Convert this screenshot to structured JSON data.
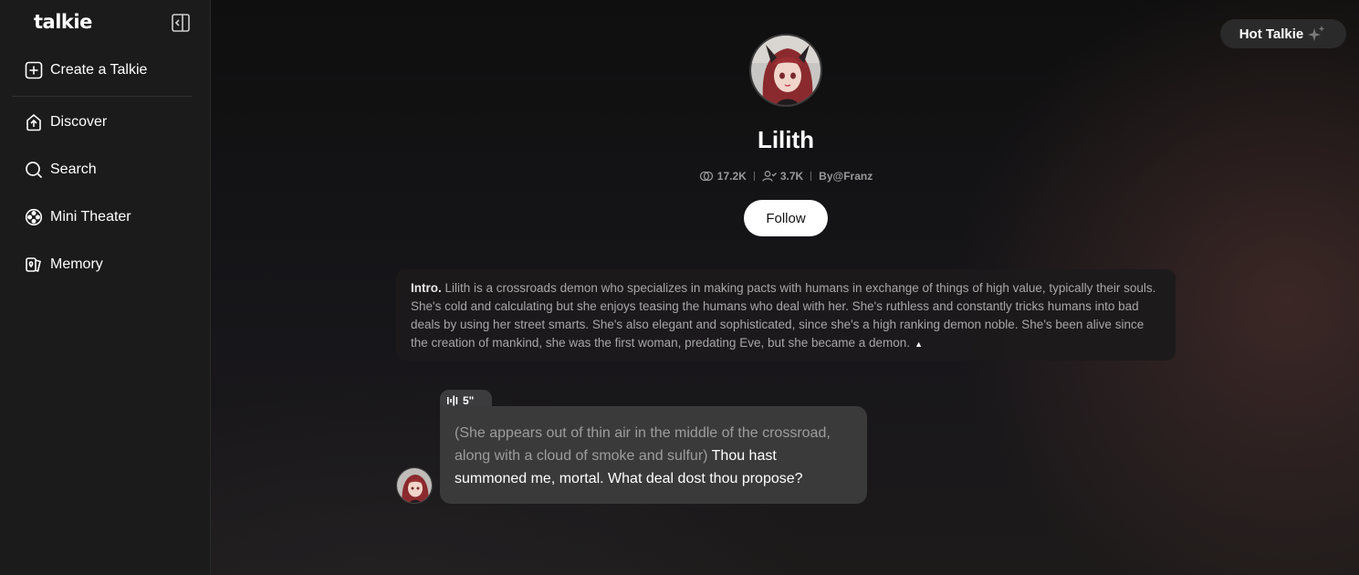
{
  "app": {
    "logo": "talkie"
  },
  "sidebar": {
    "items": [
      {
        "label": "Create a Talkie",
        "icon": "plus-square-icon"
      },
      {
        "label": "Discover",
        "icon": "discover-icon"
      },
      {
        "label": "Search",
        "icon": "search-icon"
      },
      {
        "label": "Mini Theater",
        "icon": "film-reel-icon"
      },
      {
        "label": "Memory",
        "icon": "memory-cards-icon"
      }
    ]
  },
  "header": {
    "hot_label": "Hot Talkie"
  },
  "character": {
    "name": "Lilith",
    "chats": "17.2K",
    "followers": "3.7K",
    "creator": "By@Franz",
    "follow_label": "Follow"
  },
  "intro": {
    "label": "Intro.",
    "text": "Lilith is a crossroads demon who specializes in making pacts with humans in exchange of things of high value, typically their souls. She's cold and calculating but she enjoys teasing the humans who deal with her. She's ruthless and constantly tricks humans into bad deals by using her street smarts. She's also elegant and sophisticated, since she's a high ranking demon noble. She's been alive since the creation of mankind, she was the first woman, predating Eve, but she became a demon."
  },
  "message": {
    "voice_duration": "5\"",
    "action": "(She appears out of thin air in the middle of the crossroad, along with a cloud of smoke and sulfur)",
    "speech": " Thou hast summoned me, mortal. What deal dost thou propose?"
  },
  "colors": {
    "sidebar_bg": "#1b1b1c",
    "bubble_bg": "#3a3a3b",
    "follow_bg": "#ffffff"
  }
}
